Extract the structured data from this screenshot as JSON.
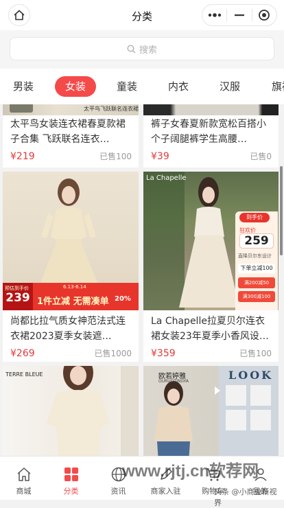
{
  "header": {
    "title": "分类"
  },
  "search": {
    "placeholder": "搜索"
  },
  "tabs": [
    {
      "label": "男装"
    },
    {
      "label": "女装"
    },
    {
      "label": "童装"
    },
    {
      "label": "内衣"
    },
    {
      "label": "汉服"
    },
    {
      "label": "旗袍"
    }
  ],
  "products": [
    {
      "name": "太平鸟女装连衣裙春夏款裙子合集 飞跃联名连衣…",
      "price": "¥219",
      "sold": "已售100",
      "img_caption": "太平鸟飞跃联名连衣裙"
    },
    {
      "name": "裤子女春夏新款宽松百搭小个子阔腿裤学生高腰…",
      "price": "¥39",
      "sold": "已售0"
    },
    {
      "name": "尚都比拉气质女神范法式连衣裙2023夏季女装遮…",
      "price": "¥269",
      "sold": "已售1000",
      "promo_tag": "预估到手价",
      "promo_price": "239",
      "promo_text": "1件立减 无需凑单",
      "promo_discount": "20%",
      "promo_date": "6.13-6.14"
    },
    {
      "name": "La Chapelle拉夏贝尔连衣裙女装23年夏季小香风设…",
      "price": "¥359",
      "sold": "已售100",
      "brand_text": "La Chapelle",
      "promo_tag1": "到手价",
      "promo_tag2": "狂欢价",
      "promo_price": "259",
      "promo_text1": "直降贝尔东设计",
      "promo_text2": "下单立减100",
      "coupon1": "满200减50",
      "coupon2": "满300减100"
    },
    {
      "name": "",
      "price": "",
      "sold": "",
      "brand_text": "TERRE BLEUE"
    },
    {
      "name": "",
      "price": "",
      "sold": "",
      "brand_text": "欧若婷雅",
      "brand_sub": "OURUOTINGYA",
      "look_text": "LOOK"
    }
  ],
  "bottom_nav": [
    {
      "label": "商城"
    },
    {
      "label": "分类"
    },
    {
      "label": "资讯"
    },
    {
      "label": "商家入驻"
    },
    {
      "label": "购物车"
    },
    {
      "label": "我的"
    }
  ],
  "watermark": {
    "main": "www.rjtj.cn软荐网",
    "sub": "头条 @小商业新视界"
  },
  "colors": {
    "accent": "#f44a4a",
    "price": "#e23a3a"
  }
}
